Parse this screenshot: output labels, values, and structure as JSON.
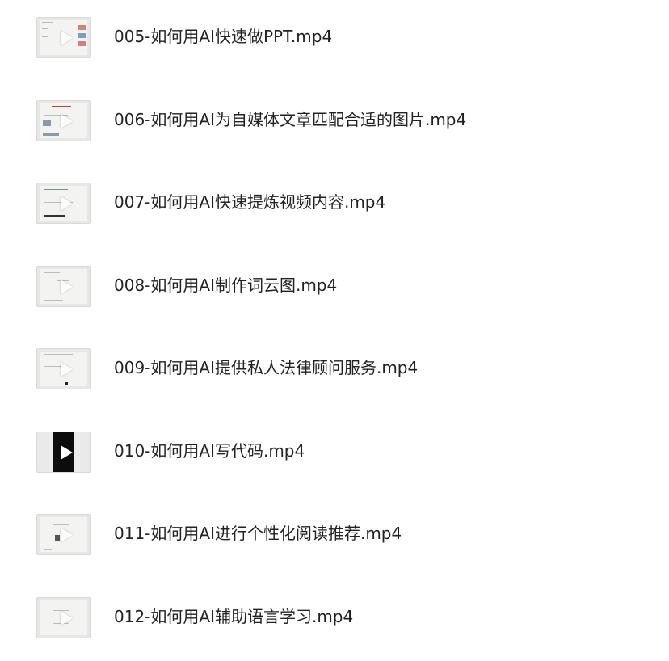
{
  "files": [
    {
      "name": "005-如何用AI快速做PPT.mp4",
      "icon": "video-thumbnail"
    },
    {
      "name": "006-如何用AI为自媒体文章匹配合适的图片.mp4",
      "icon": "video-thumbnail"
    },
    {
      "name": "007-如何用AI快速提炼视频内容.mp4",
      "icon": "video-thumbnail"
    },
    {
      "name": "008-如何用AI制作词云图.mp4",
      "icon": "video-thumbnail"
    },
    {
      "name": "009-如何用AI提供私人法律顾问服务.mp4",
      "icon": "video-thumbnail"
    },
    {
      "name": "010-如何用AI写代码.mp4",
      "icon": "video-thumbnail"
    },
    {
      "name": "011-如何用AI进行个性化阅读推荐.mp4",
      "icon": "video-thumbnail"
    },
    {
      "name": "012-如何用AI辅助语言学习.mp4",
      "icon": "video-thumbnail"
    }
  ]
}
